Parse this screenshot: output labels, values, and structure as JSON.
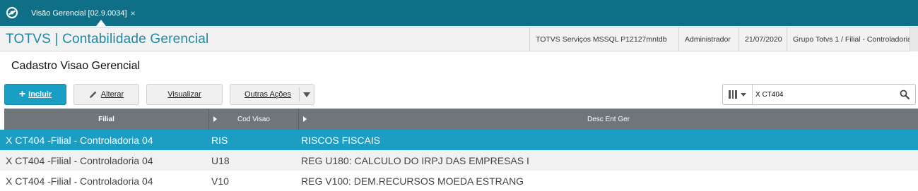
{
  "topbar": {
    "tab_label": "Visão Gerencial [02.9.0034]",
    "tab_close": "×"
  },
  "header": {
    "app_title": "TOTVS | Contabilidade Gerencial",
    "server": "TOTVS Serviços MSSQL P12127mntdb",
    "user": "Administrador",
    "date": "21/07/2020",
    "group": "Grupo Totvs 1 / Filial - Controladoria"
  },
  "page": {
    "title": "Cadastro Visao Gerencial"
  },
  "toolbar": {
    "incluir": "Incluir",
    "alterar": "Alterar",
    "visualizar": "Visualizar",
    "outras": "Outras Ações"
  },
  "search": {
    "value": "X CT404"
  },
  "table": {
    "columns": [
      "Filial",
      "Cod Visao",
      "Desc Ent Ger"
    ],
    "rows": [
      {
        "filial": "X CT404 -Filial - Controladoria 04",
        "cod": "RIS",
        "desc": "RISCOS FISCAIS"
      },
      {
        "filial": "X CT404 -Filial - Controladoria 04",
        "cod": "U18",
        "desc": "REG U180: CALCULO DO IRPJ DAS EMPRESAS I"
      },
      {
        "filial": "X CT404 -Filial - Controladoria 04",
        "cod": "V10",
        "desc": "REG V100: DEM.RECURSOS MOEDA ESTRANG"
      }
    ]
  },
  "colors": {
    "topbar": "#0e6f86",
    "accent": "#1a9ec4",
    "title": "#1d87a8",
    "grid_header": "#6e767b"
  }
}
